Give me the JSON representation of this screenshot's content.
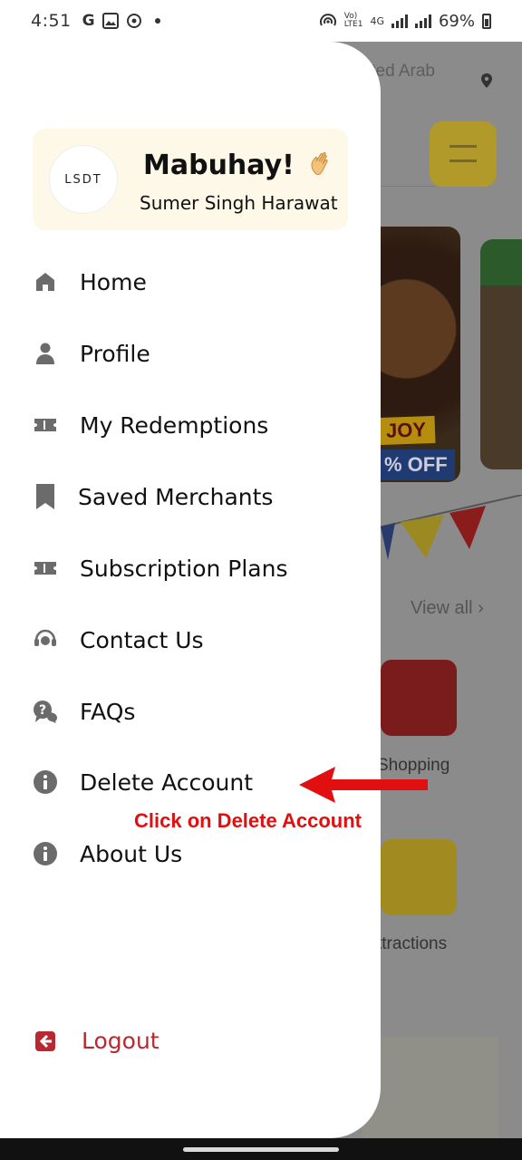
{
  "status_bar": {
    "time": "4:51",
    "left_glyphs": [
      "G"
    ],
    "net_label_1": "Vo)",
    "net_label_2": "LTE1",
    "net_type": "4G",
    "battery": "69%"
  },
  "background": {
    "location_text": "ited Arab",
    "promo_badge_1": "JOY",
    "promo_badge_2": "% OFF",
    "view_all": "View all",
    "view_all_chevron": "›",
    "tile_1_label": "Shopping",
    "tile_2_label": "ttractions"
  },
  "drawer": {
    "avatar_logo": "LSDT",
    "greeting": "Mabuhay!",
    "user_name": "Sumer Singh Harawat",
    "menu": [
      {
        "label": "Home",
        "icon": "home-icon"
      },
      {
        "label": "Profile",
        "icon": "person-icon"
      },
      {
        "label": "My Redemptions",
        "icon": "ticket-icon"
      },
      {
        "label": "Saved Merchants",
        "icon": "bookmark-icon"
      },
      {
        "label": "Subscription Plans",
        "icon": "ticket-icon"
      },
      {
        "label": "Contact Us",
        "icon": "headset-icon"
      },
      {
        "label": "FAQs",
        "icon": "question-chat-icon"
      },
      {
        "label": "Delete Account",
        "icon": "info-icon"
      },
      {
        "label": "About Us",
        "icon": "info-icon"
      }
    ],
    "logout_label": "Logout"
  },
  "annotation": {
    "text": "Click on Delete Account",
    "color": "#e10f0f"
  },
  "colors": {
    "logout": "#b8292f",
    "profile_card": "#fdf8e7",
    "icon_gray": "#6b6b6b"
  }
}
